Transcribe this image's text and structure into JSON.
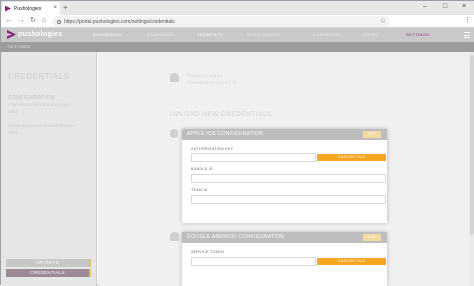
{
  "browser": {
    "tab_title": "Pushologies",
    "tab_close": "×",
    "new_tab": "+",
    "url": "https://portal.pushologies.com/settings/credentials",
    "window_controls": [
      "–",
      "□",
      "×"
    ]
  },
  "app": {
    "logo": "pushologies",
    "nav": [
      "DASHBOARD",
      "CAMPAIGNS",
      "SEGMENTS",
      "SUBSCRIBERS",
      "CAMPAIGNS",
      "USERS",
      "SETTINGS"
    ],
    "breadcrumb": "SETTINGS"
  },
  "sidebar": {
    "title": "CREDENTIALS",
    "section": "CONFIGURATION",
    "text1": "LOAD YOUR CERTIFICATE DETAILS",
    "link1": "HERE",
    "text2": "REFER TO GOOGLE DOCUMENTATION",
    "link2": "HERE",
    "buttons": [
      "API KEYS",
      "CREDENTIALS"
    ]
  },
  "main": {
    "faint_line1": "PUSHOLO EMAIL",
    "faint_line2": "PUSHOLO PROJECT ID",
    "upload_title": "UPLOAD NEW CREDENTIALS",
    "ios": {
      "title": "APPLE IOS CONFIGURATION",
      "edit": "EDIT",
      "auth_label": "AUTHORIZATION KEY",
      "choose": "CHOOSE FILE",
      "bundle_label": "BUNDLE ID",
      "team_label": "TEAM ID"
    },
    "android": {
      "title": "GOOGLE ANDROID CONFIGURATION",
      "edit": "EDIT",
      "token_label": "SERVICE TOKEN",
      "choose": "CHOOSE FILE"
    }
  },
  "colors": {
    "brand": "#8a1f7a",
    "orange": "#f6a623",
    "header_gray": "#c9c9c9"
  }
}
